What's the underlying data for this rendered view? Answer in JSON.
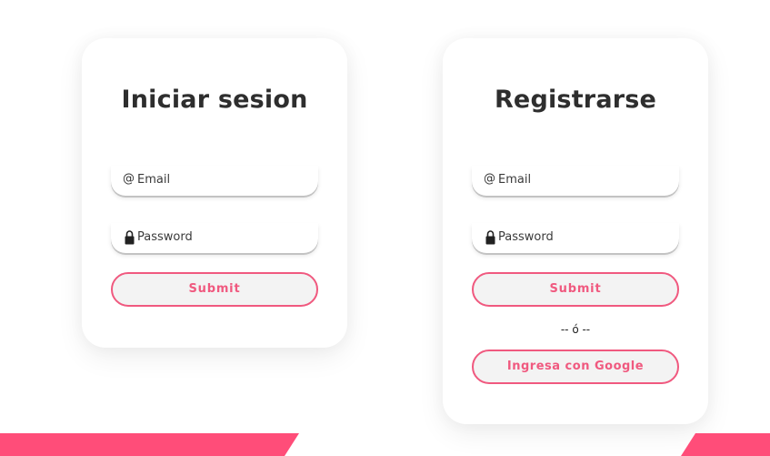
{
  "login": {
    "title": "Iniciar sesion",
    "email_icon": "@",
    "email_placeholder": "Email",
    "password_icon": "lock-icon",
    "password_placeholder": "Password",
    "submit_label": "Submit"
  },
  "register": {
    "title": "Registrarse",
    "email_icon": "@",
    "email_placeholder": "Email",
    "password_icon": "lock-icon",
    "password_placeholder": "Password",
    "submit_label": "Submit",
    "separator": "-- ó --",
    "google_label": "Ingresa con Google"
  },
  "colors": {
    "accent": "#f0597f",
    "band": "#ff4d79",
    "title": "#2e2e2e"
  }
}
